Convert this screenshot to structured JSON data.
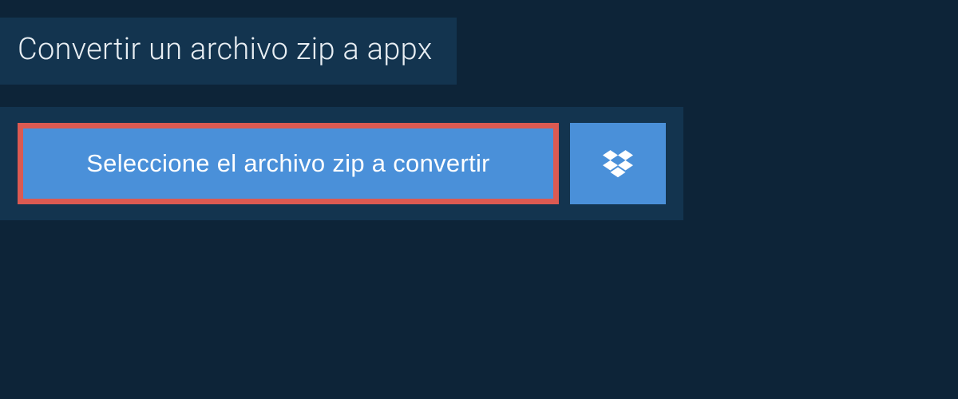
{
  "header": {
    "title": "Convertir un archivo zip a appx"
  },
  "actions": {
    "select_file_label": "Seleccione el archivo zip a convertir",
    "dropbox_icon": "dropbox-icon"
  },
  "colors": {
    "page_bg": "#0d2438",
    "panel_bg": "#13344f",
    "button_bg": "#4a90d9",
    "highlight_border": "#db5a52",
    "text_light": "#e8eef3"
  }
}
